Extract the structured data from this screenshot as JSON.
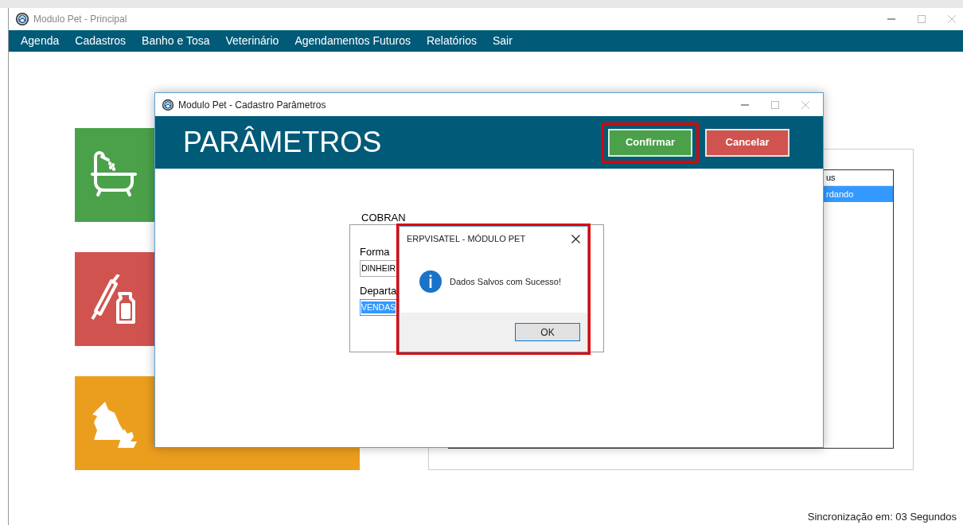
{
  "main_window": {
    "title": "Modulo Pet - Principal",
    "menu": [
      "Agenda",
      "Cadastros",
      "Banho e Tosa",
      "Veterinário",
      "Agendamentos Futuros",
      "Relatórios",
      "Sair"
    ]
  },
  "tiles": [
    {
      "kind": "bath",
      "color": "#4aa14a"
    },
    {
      "kind": "vet",
      "color": "#d0534f"
    },
    {
      "kind": "pets",
      "color": "#eb9e1e"
    }
  ],
  "agenda_table": {
    "column": "us",
    "rows": [
      {
        "text": "rdando",
        "selected": true
      }
    ]
  },
  "dialog": {
    "title": "Modulo Pet - Cadastro Parâmetros",
    "heading": "PARÂMETROS",
    "buttons": [
      {
        "kind": "confirm",
        "label": "Confirmar",
        "highlighted": true
      },
      {
        "kind": "cancel",
        "label": "Cancelar",
        "highlighted": false
      }
    ],
    "group": {
      "legend": "COBRAN",
      "fields": [
        {
          "label": "Forma",
          "value": "DINHEIR",
          "selected": false
        },
        {
          "label": "Departa",
          "value": "VENDAS",
          "selected": true
        }
      ]
    }
  },
  "message_box": {
    "title": "ERPVISATEL - MÓDULO PET",
    "message": "Dados Salvos com Sucesso!",
    "button": "OK",
    "highlighted": true
  },
  "status_bar": "Sincronização em: 03 Segundos"
}
